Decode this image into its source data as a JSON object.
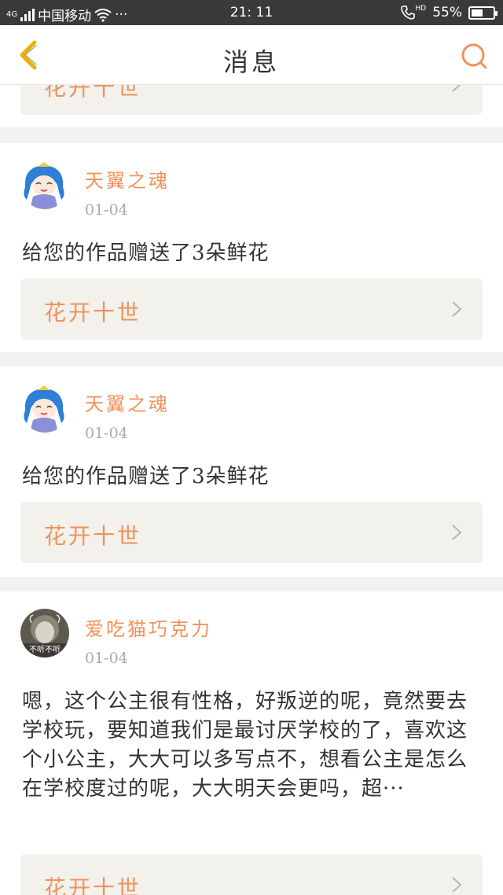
{
  "status_bar": {
    "network": "4G",
    "carrier": "中国移动",
    "more": "···",
    "time": "21: 11",
    "hd": "HD",
    "battery_text": "55%",
    "battery_level": 0.55
  },
  "header": {
    "title": "消息"
  },
  "feed": {
    "partial_top": {
      "work_title": "花开十世"
    },
    "items": [
      {
        "user": "天翼之魂",
        "date": "01-04",
        "message": "给您的作品赠送了3朵鲜花",
        "work_title": "花开十世"
      },
      {
        "user": "天翼之魂",
        "date": "01-04",
        "message": "给您的作品赠送了3朵鲜花",
        "work_title": "花开十世"
      },
      {
        "user": "爱吃猫巧克力",
        "date": "01-04",
        "avatar_text": "不听不听",
        "message": "嗯，这个公主很有性格，好叛逆的呢，竟然要去学校玩，要知道我们是最讨厌学校的了，喜欢这个小公主，大大可以多写点不，想看公主是怎么在学校度过的呢，大大明天会更吗，超···",
        "work_title": "花开十世"
      }
    ]
  },
  "colors": {
    "accent": "#f0925a",
    "back_arrow": "#e8b400",
    "card_link_bg": "#f2f1ec"
  },
  "icons": [
    "back-arrow-icon",
    "search-icon",
    "chevron-right-icon",
    "wifi-icon",
    "signal-icon",
    "phone-hd-icon",
    "battery-icon"
  ]
}
